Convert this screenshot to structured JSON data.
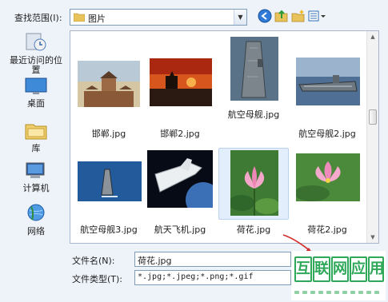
{
  "lookin": {
    "label": "查找范围(I):",
    "value": "图片"
  },
  "places": [
    {
      "label": "最近访问的位置",
      "icon": "recent-places-icon"
    },
    {
      "label": "桌面",
      "icon": "desktop-icon"
    },
    {
      "label": "库",
      "icon": "libraries-icon"
    },
    {
      "label": "计算机",
      "icon": "computer-icon"
    },
    {
      "label": "网络",
      "icon": "network-icon"
    }
  ],
  "files": [
    {
      "name": "邯郸.jpg",
      "selected": false
    },
    {
      "name": "邯郸2.jpg",
      "selected": false
    },
    {
      "name": "航空母舰.jpg",
      "selected": false
    },
    {
      "name": "航空母舰2.jpg",
      "selected": false
    },
    {
      "name": "航空母舰3.jpg",
      "selected": false
    },
    {
      "name": "航天飞机.jpg",
      "selected": false
    },
    {
      "name": "荷花.jpg",
      "selected": true
    },
    {
      "name": "荷花2.jpg",
      "selected": false
    }
  ],
  "filename": {
    "label": "文件名(N):",
    "value": "荷花.jpg"
  },
  "filetype": {
    "label": "文件类型(T):",
    "value": "*.jpg;*.jpeg;*.png;*.gif"
  },
  "watermark": {
    "chars": [
      "互",
      "联",
      "网",
      "应",
      "用"
    ]
  },
  "colors": {
    "accent": "#2fa85a",
    "selection": "#e3eefc",
    "arrow": "#d12a2a"
  }
}
